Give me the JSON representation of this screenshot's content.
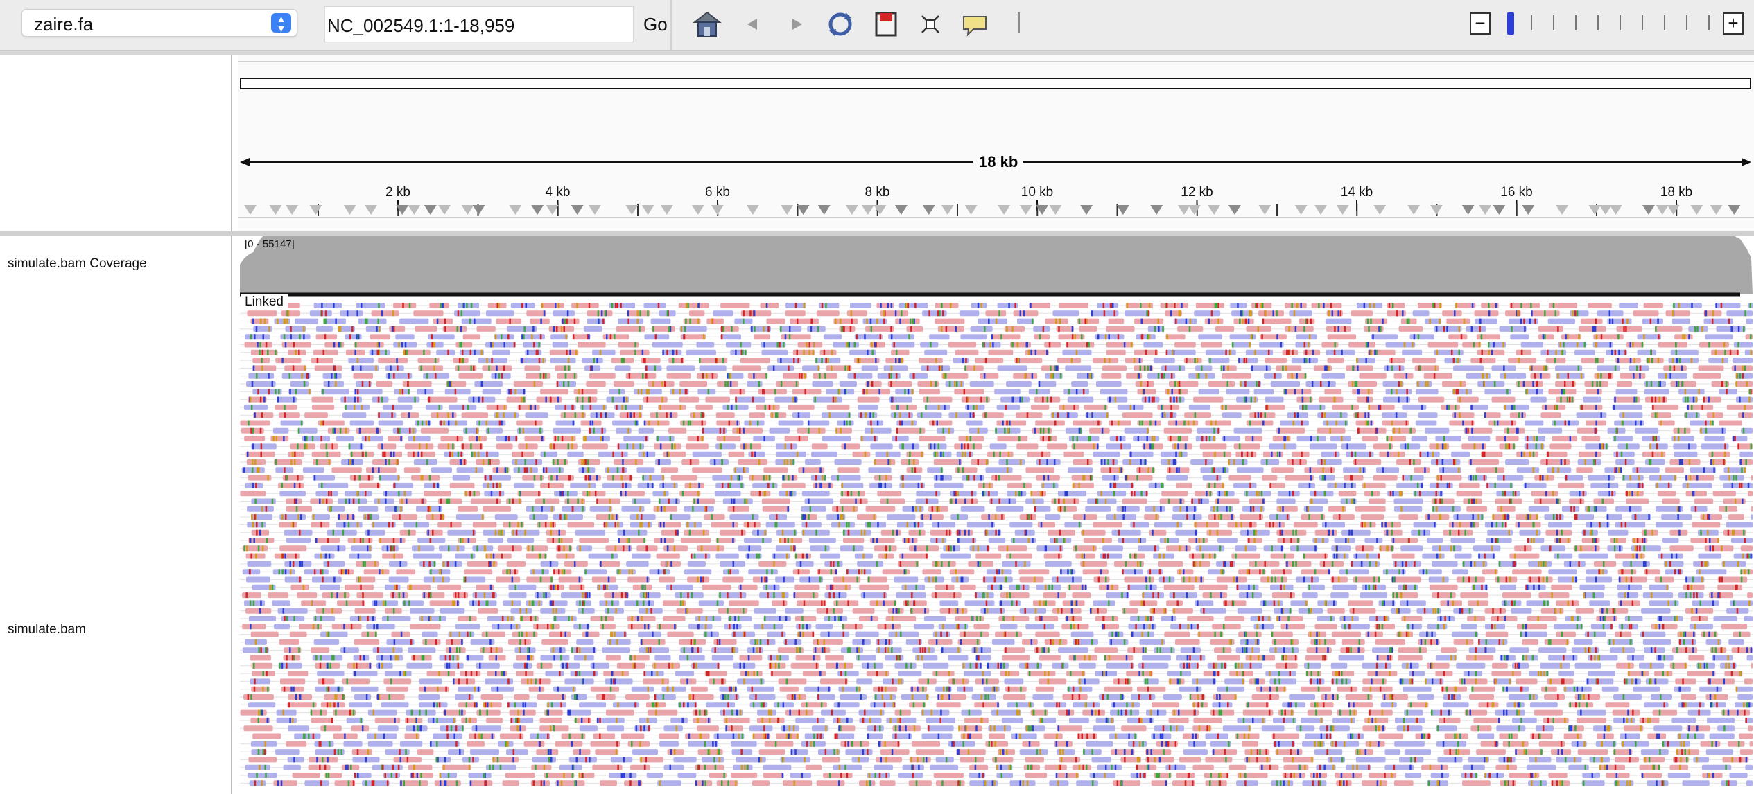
{
  "toolbar": {
    "genome": "zaire.fa",
    "locus": "NC_002549.1:1-18,959",
    "go_label": "Go",
    "icons": [
      "home-icon",
      "back-icon",
      "forward-icon",
      "refresh-icon",
      "region-icon",
      "fit-icon",
      "popup-icon"
    ]
  },
  "ruler": {
    "span_label": "18 kb",
    "ticks": [
      "2 kb",
      "4 kb",
      "6 kb",
      "8 kb",
      "10 kb",
      "12 kb",
      "14 kb",
      "16 kb",
      "18 kb"
    ]
  },
  "tracks": {
    "coverage_name": "simulate.bam Coverage",
    "coverage_range": "[0 - 55147]",
    "alignment_name": "simulate.bam",
    "linked_label": "Linked"
  },
  "colors": {
    "coverage": "#a8a8a8",
    "read_fwd": "#eaa5ab",
    "read_rev": "#b0b0ec",
    "base_A": "#3fa63f",
    "base_C": "#2b3fd6",
    "base_G": "#d59a1c",
    "base_T": "#d42424",
    "accent": "#3b82f6"
  }
}
